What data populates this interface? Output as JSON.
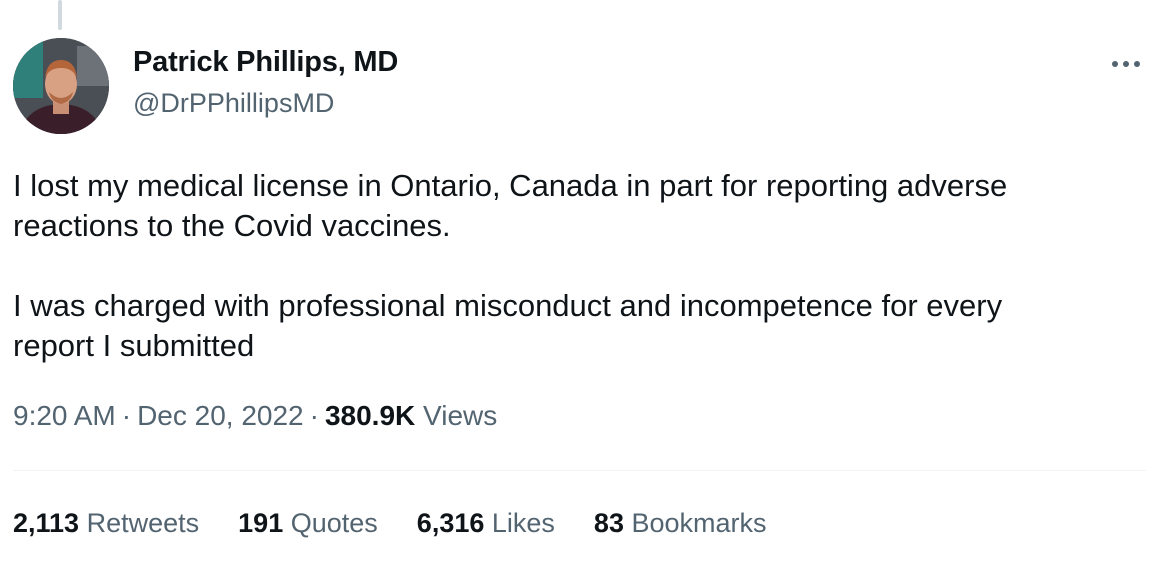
{
  "colors": {
    "primary_text": "#0f1419",
    "secondary_text": "#536471",
    "divider": "#eff3f4",
    "thread_line": "#cfd9de"
  },
  "author": {
    "display_name": "Patrick Phillips, MD",
    "handle": "@DrPPhillipsMD",
    "avatar_icon": "profile-photo"
  },
  "menu": {
    "more_icon": "ellipsis-icon"
  },
  "tweet": {
    "paragraphs": [
      "I lost my medical license in Ontario, Canada in part for reporting adverse reactions to the Covid vaccines.",
      "I was charged with professional misconduct and incompetence for every report I submitted"
    ],
    "lines": [
      "I lost my medical license in Ontario, Canada in part for reporting adverse",
      "reactions to the Covid vaccines.",
      "I was charged with professional misconduct and incompetence for every",
      "report I submitted"
    ]
  },
  "meta": {
    "time": "9:20 AM",
    "separator": "·",
    "date": "Dec 20, 2022",
    "views_count": "380.9K",
    "views_label": "Views"
  },
  "stats": {
    "retweets": {
      "count": "2,113",
      "label": "Retweets"
    },
    "quotes": {
      "count": "191",
      "label": "Quotes"
    },
    "likes": {
      "count": "6,316",
      "label": "Likes"
    },
    "bookmarks": {
      "count": "83",
      "label": "Bookmarks"
    }
  }
}
